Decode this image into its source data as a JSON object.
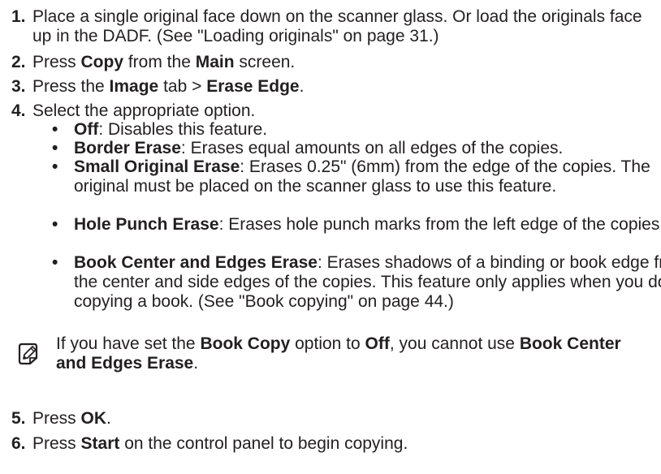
{
  "steps": [
    {
      "num": "1.",
      "segments": [
        {
          "t": "Place a single original face down on the scanner glass. Or load the originals face up in the DADF. (See \"Loading originals\" on page 31.)",
          "b": false
        }
      ]
    },
    {
      "num": "2.",
      "segments": [
        {
          "t": "Press ",
          "b": false
        },
        {
          "t": "Copy",
          "b": true
        },
        {
          "t": " from the ",
          "b": false
        },
        {
          "t": "Main",
          "b": true
        },
        {
          "t": " screen.",
          "b": false
        }
      ]
    },
    {
      "num": "3.",
      "segments": [
        {
          "t": "Press the ",
          "b": false
        },
        {
          "t": "Image",
          "b": true
        },
        {
          "t": " tab > ",
          "b": false
        },
        {
          "t": "Erase Edge",
          "b": true
        },
        {
          "t": ".",
          "b": false
        }
      ]
    },
    {
      "num": "4.",
      "segments": [
        {
          "t": "Select the appropriate option.",
          "b": false
        }
      ]
    },
    {
      "num": "5.",
      "segments": [
        {
          "t": "Press ",
          "b": false
        },
        {
          "t": "OK",
          "b": true
        },
        {
          "t": ".",
          "b": false
        }
      ]
    },
    {
      "num": "6.",
      "segments": [
        {
          "t": "Press ",
          "b": false
        },
        {
          "t": "Start",
          "b": true
        },
        {
          "t": " on the control panel to begin copying.",
          "b": false
        }
      ]
    }
  ],
  "bullet_symbol": "•",
  "options": [
    {
      "term": "Off",
      "desc": ": Disables this feature."
    },
    {
      "term": "Border Erase",
      "desc": ": Erases equal amounts on all edges of the copies."
    },
    {
      "term": "Small Original Erase",
      "desc": ": Erases 0.25\" (6mm) from the edge of the copies. The original must be placed on the scanner glass to use this feature."
    },
    {
      "term": "Hole Punch Erase",
      "desc": ": Erases hole punch marks from the left edge of the copies."
    },
    {
      "term": "Book Center and Edges Erase",
      "desc": ": Erases shadows of a binding or book edge from the center and side edges of the copies. This feature only applies when you do copying a book. (See \"Book copying\" on page 44.)"
    }
  ],
  "note": {
    "icon": "note-pencil-icon",
    "segments": [
      {
        "t": "If you have set the ",
        "b": false
      },
      {
        "t": "Book Copy",
        "b": true
      },
      {
        "t": " option to ",
        "b": false
      },
      {
        "t": "Off",
        "b": true
      },
      {
        "t": ", you cannot use ",
        "b": false
      },
      {
        "t": "Book Center and Edges Erase",
        "b": true
      },
      {
        "t": ".",
        "b": false
      }
    ]
  },
  "colors": {
    "text": "#231f20",
    "icon_stroke": "#231f20"
  }
}
